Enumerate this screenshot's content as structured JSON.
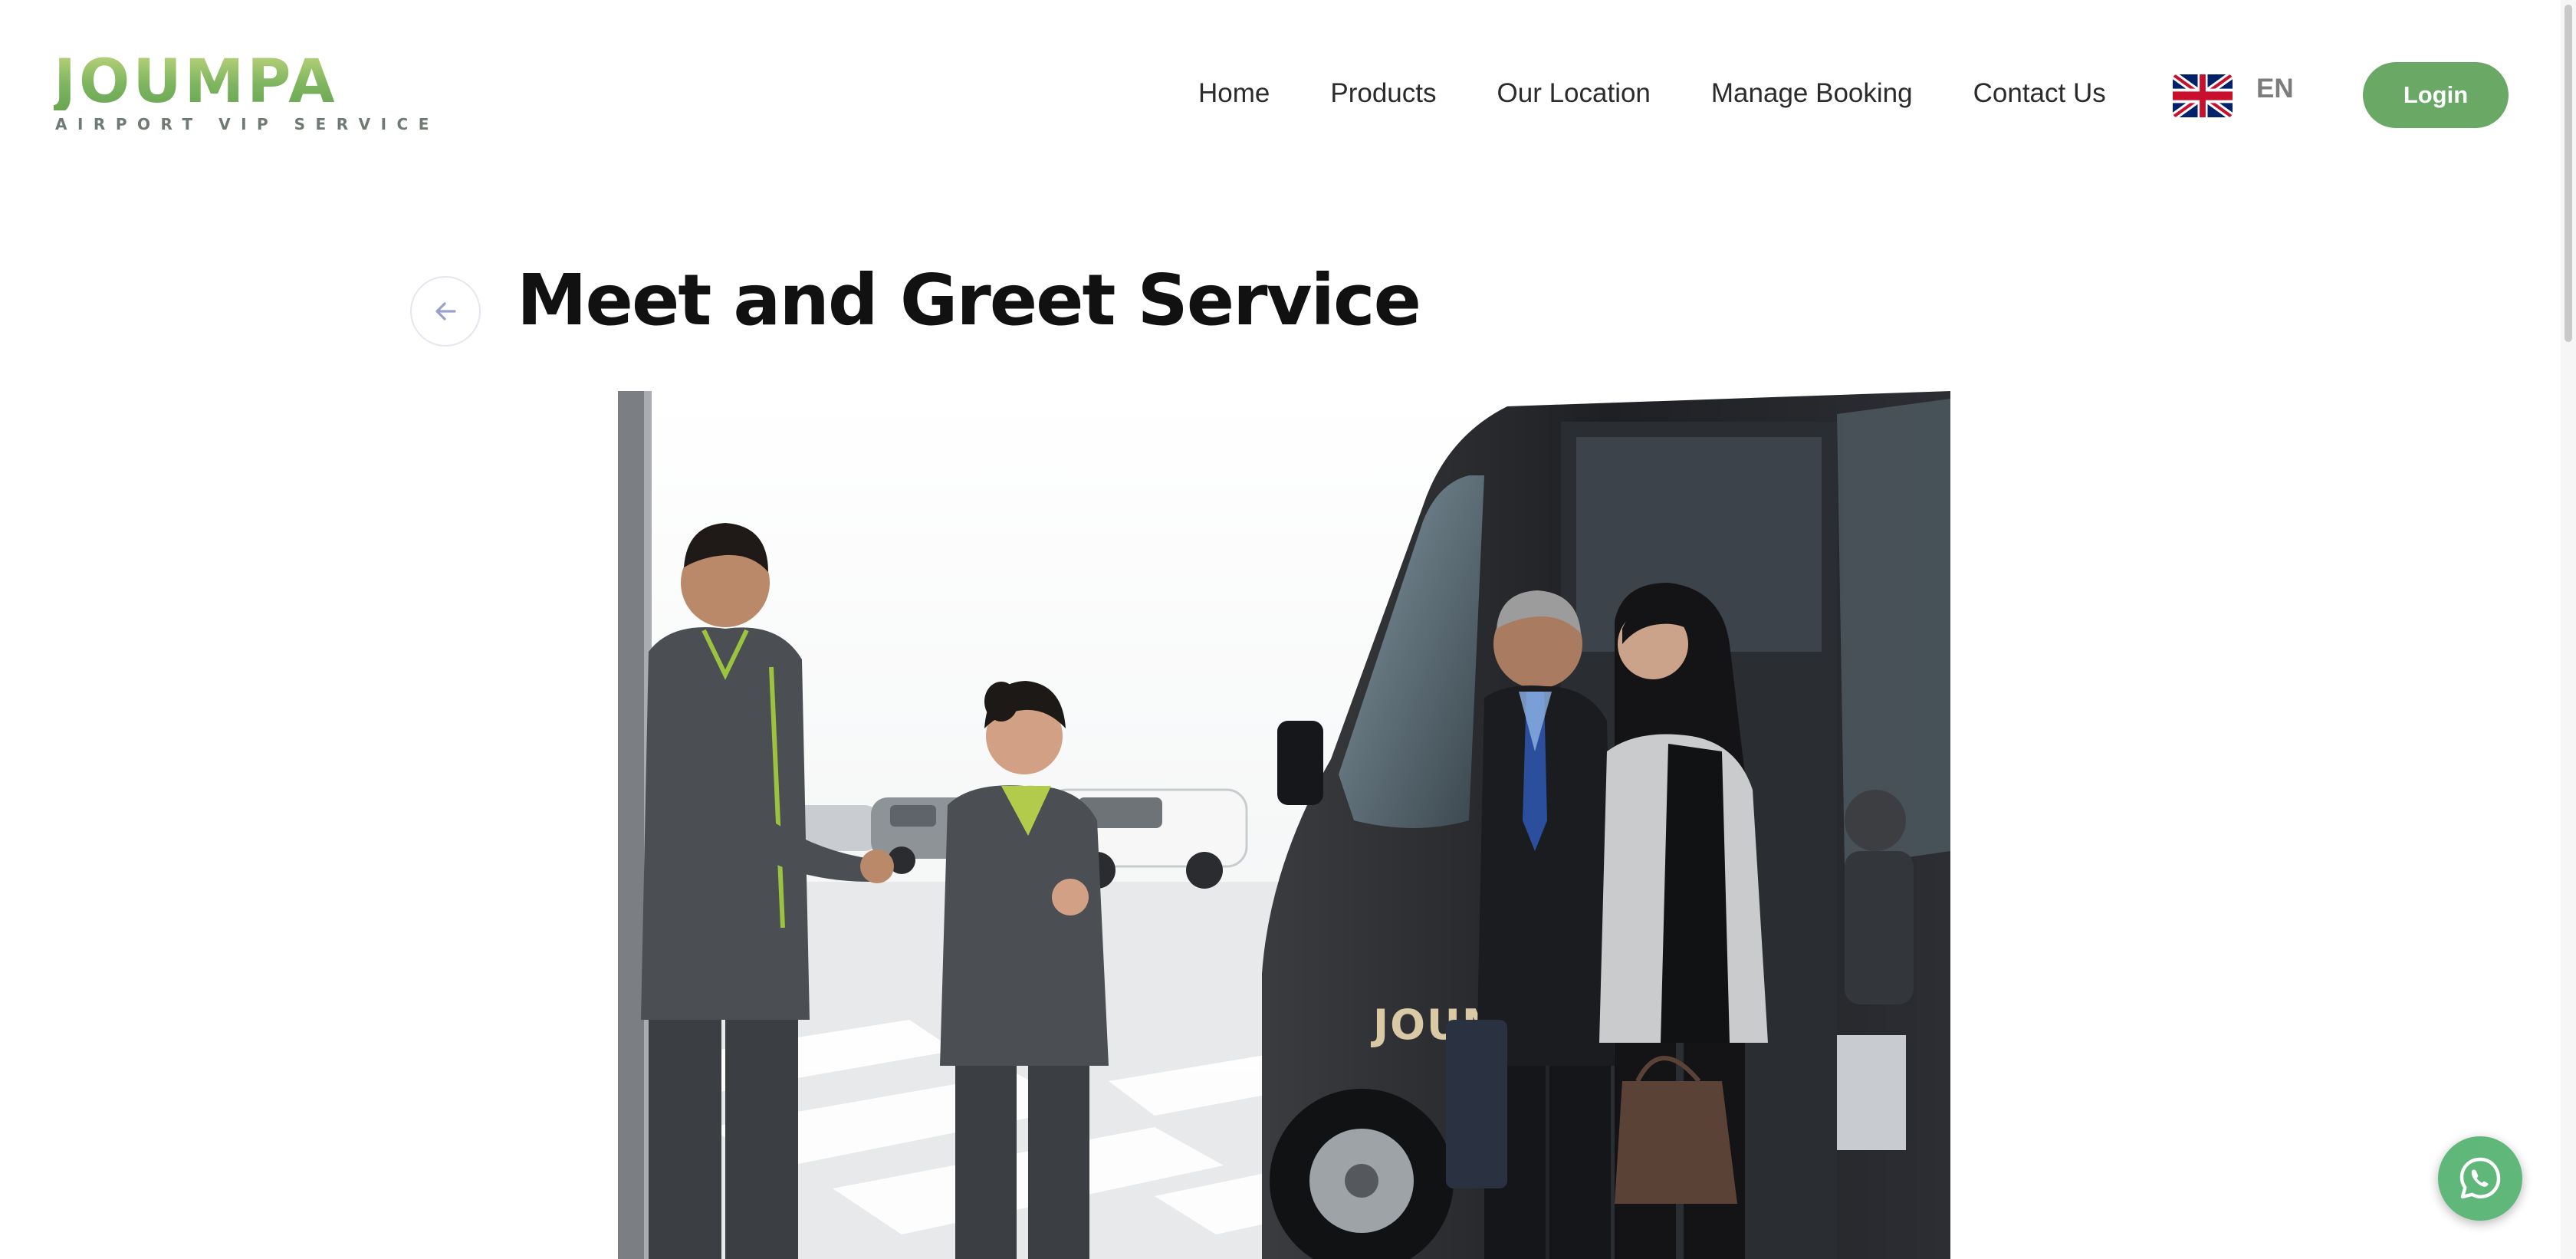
{
  "brand": {
    "name": "JOUMPA",
    "tagline": "AIRPORT VIP SERVICE",
    "accent_color": "#6aa965"
  },
  "nav": {
    "items": [
      {
        "label": "Home"
      },
      {
        "label": "Products"
      },
      {
        "label": "Our Location"
      },
      {
        "label": "Manage Booking"
      },
      {
        "label": "Contact Us"
      }
    ],
    "language": {
      "code": "EN",
      "flag_icon": "uk-flag-icon"
    },
    "login_label": "Login"
  },
  "page": {
    "back_icon": "arrow-left-icon",
    "title": "Meet and Greet Service"
  },
  "hero": {
    "van_logo": "JOUMPA"
  },
  "floating": {
    "whatsapp_icon": "whatsapp-icon",
    "whatsapp_color": "#5fb77a"
  }
}
